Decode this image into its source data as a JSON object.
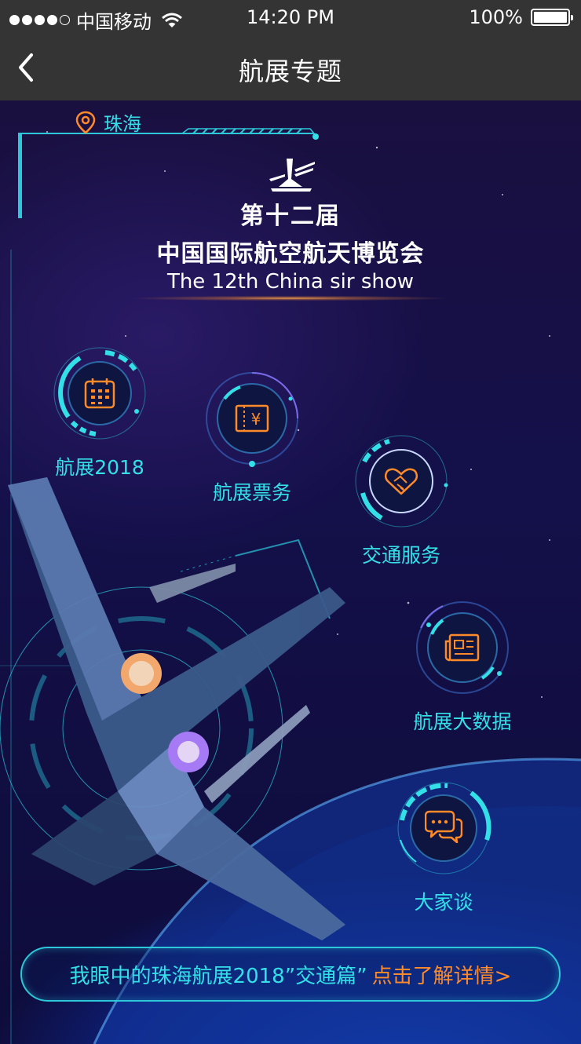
{
  "status_bar": {
    "carrier": "中国移动",
    "time": "14:20 PM",
    "battery": "100%"
  },
  "nav": {
    "title": "航展专题"
  },
  "location": "珠海",
  "headline": {
    "line1": "第十二届",
    "line2": "中国国际航空航天博览会",
    "line3": "The 12th China sir show"
  },
  "features": [
    {
      "label": "航展2018",
      "icon": "calendar-icon"
    },
    {
      "label": "航展票务",
      "icon": "ticket-icon"
    },
    {
      "label": "交通服务",
      "icon": "handshake-icon"
    },
    {
      "label": "航展大数据",
      "icon": "news-icon"
    },
    {
      "label": "大家谈",
      "icon": "chat-icon"
    }
  ],
  "banner": {
    "text": "我眼中的珠海航展2018”交通篇”",
    "link": "点击了解详情>"
  },
  "colors": {
    "accent_cyan": "#34e0e8",
    "accent_orange": "#ff8a2a",
    "bar_bg": "#343434"
  }
}
